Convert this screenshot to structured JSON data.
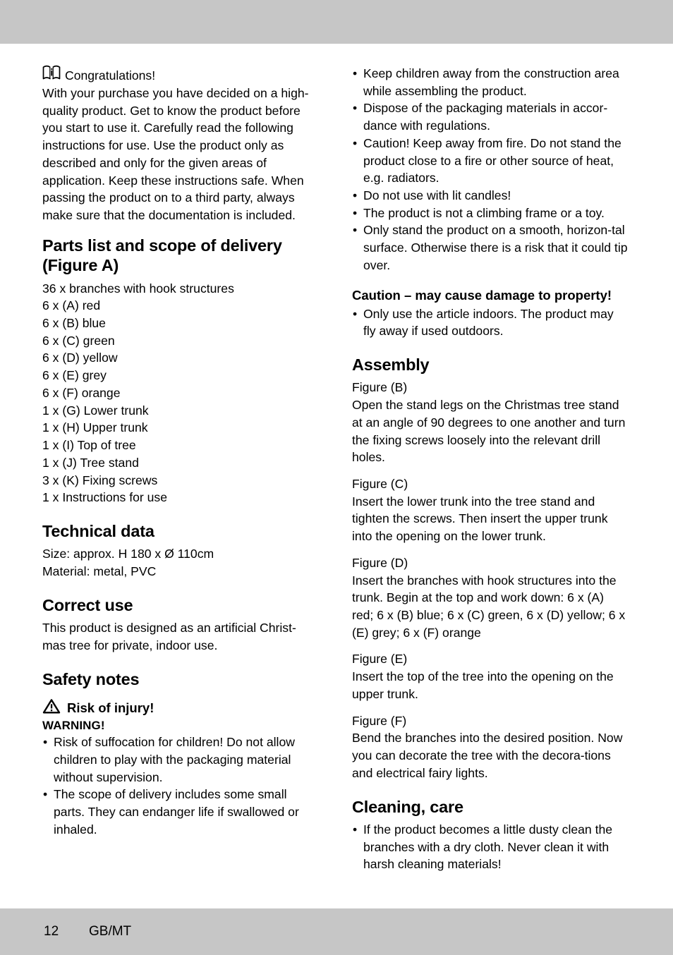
{
  "bands": {
    "color": "#c6c6c6"
  },
  "left_column": {
    "intro": {
      "icon": "manual-book-icon",
      "heading": "Congratulations!",
      "body": "With your purchase you have decided on a high-quality product. Get to know the product before you start to use it. Carefully read the following instructions for use. Use the product only as described and only for the given areas of application. Keep these instructions safe. When passing the product on to a third party, always make sure that the documentation is included."
    },
    "parts": {
      "heading": "Parts list and scope of delivery (Figure A)",
      "items": [
        "36 x branches with hook structures",
        "6 x (A) red",
        "6 x (B) blue",
        "6 x (C) green",
        "6 x (D) yellow",
        "6 x (E) grey",
        "6 x (F) orange",
        "1 x (G) Lower trunk",
        "1 x (H) Upper trunk",
        "1 x (I) Top of tree",
        "1 x (J) Tree stand",
        "3 x (K) Fixing screws",
        "1 x Instructions for use"
      ]
    },
    "technical": {
      "heading": "Technical data",
      "lines": [
        "Size: approx. H 180 x Ø 110cm",
        "Material: metal, PVC"
      ]
    },
    "correct_use": {
      "heading": "Correct use",
      "body": "This product is designed as an artificial Christ-mas tree for private, indoor use."
    },
    "safety": {
      "heading": "Safety notes",
      "risk_icon": "warning-triangle-icon",
      "risk_title": "Risk of injury!",
      "warning_label": "WARNING!",
      "bullets": [
        "Risk of suffocation for children! Do not allow children to play with the packaging material without supervision.",
        "The scope of delivery includes some small parts. They can endanger life if swallowed or inhaled."
      ]
    }
  },
  "right_column": {
    "safety_continued": [
      "Keep children away from the construction area while assembling the product.",
      "Dispose of the packaging materials in accor-dance with regulations.",
      "Caution! Keep away from fire. Do not stand the product close to a fire or other source of heat, e.g. radiators.",
      "Do not use with lit candles!",
      "The product is not a climbing frame or a toy.",
      "Only stand the product on a smooth, horizon-tal surface. Otherwise there is a risk that it could tip over."
    ],
    "caution": {
      "heading": "Caution – may cause damage to property!",
      "bullets": [
        "Only use the article indoors. The product may fly away if used outdoors."
      ]
    },
    "assembly": {
      "heading": "Assembly",
      "steps": [
        {
          "figure": "Figure (B)",
          "text": "Open the stand legs on the Christmas tree stand at an angle of 90 degrees to one another and turn the fixing screws loosely into the relevant drill holes."
        },
        {
          "figure": "Figure (C)",
          "text": "Insert the lower trunk into the tree stand and tighten the screws. Then insert the upper trunk into the opening on the lower trunk."
        },
        {
          "figure": "Figure (D)",
          "text": "Insert the branches with hook structures into the trunk. Begin at the top and work down: 6 x (A) red; 6 x (B) blue; 6 x (C) green, 6 x (D) yellow; 6 x (E) grey; 6 x (F) orange"
        },
        {
          "figure": "Figure (E)",
          "text": "Insert the top of the tree into the opening on the upper trunk."
        },
        {
          "figure": "Figure (F)",
          "text": "Bend the branches into the desired position. Now you can decorate the tree with the decora-tions and electrical fairy lights."
        }
      ]
    },
    "cleaning": {
      "heading": "Cleaning, care",
      "bullets": [
        "If the product becomes a little dusty clean the branches with a dry cloth. Never clean it with harsh cleaning materials!"
      ]
    }
  },
  "footer": {
    "page_number": "12",
    "locale": "GB/MT"
  }
}
